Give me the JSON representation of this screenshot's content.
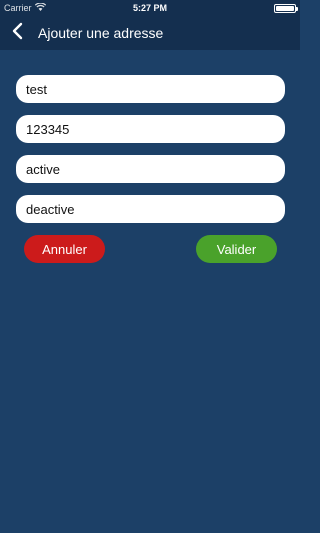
{
  "status_bar": {
    "carrier": "Carrier",
    "time": "5:27 PM",
    "wifi_icon": "wifi-icon",
    "battery_icon": "battery-icon",
    "battery_level": 1.0
  },
  "nav": {
    "back_icon": "chevron-left-icon",
    "title": "Ajouter une adresse"
  },
  "form": {
    "fields": [
      {
        "value": "test"
      },
      {
        "value": "123345"
      },
      {
        "value": "active"
      },
      {
        "value": "deactive"
      }
    ],
    "cancel_label": "Annuler",
    "submit_label": "Valider"
  },
  "colors": {
    "background": "#1c4067",
    "nav": "#142f4f",
    "cancel": "#cc1b1b",
    "submit": "#4aa22b"
  }
}
